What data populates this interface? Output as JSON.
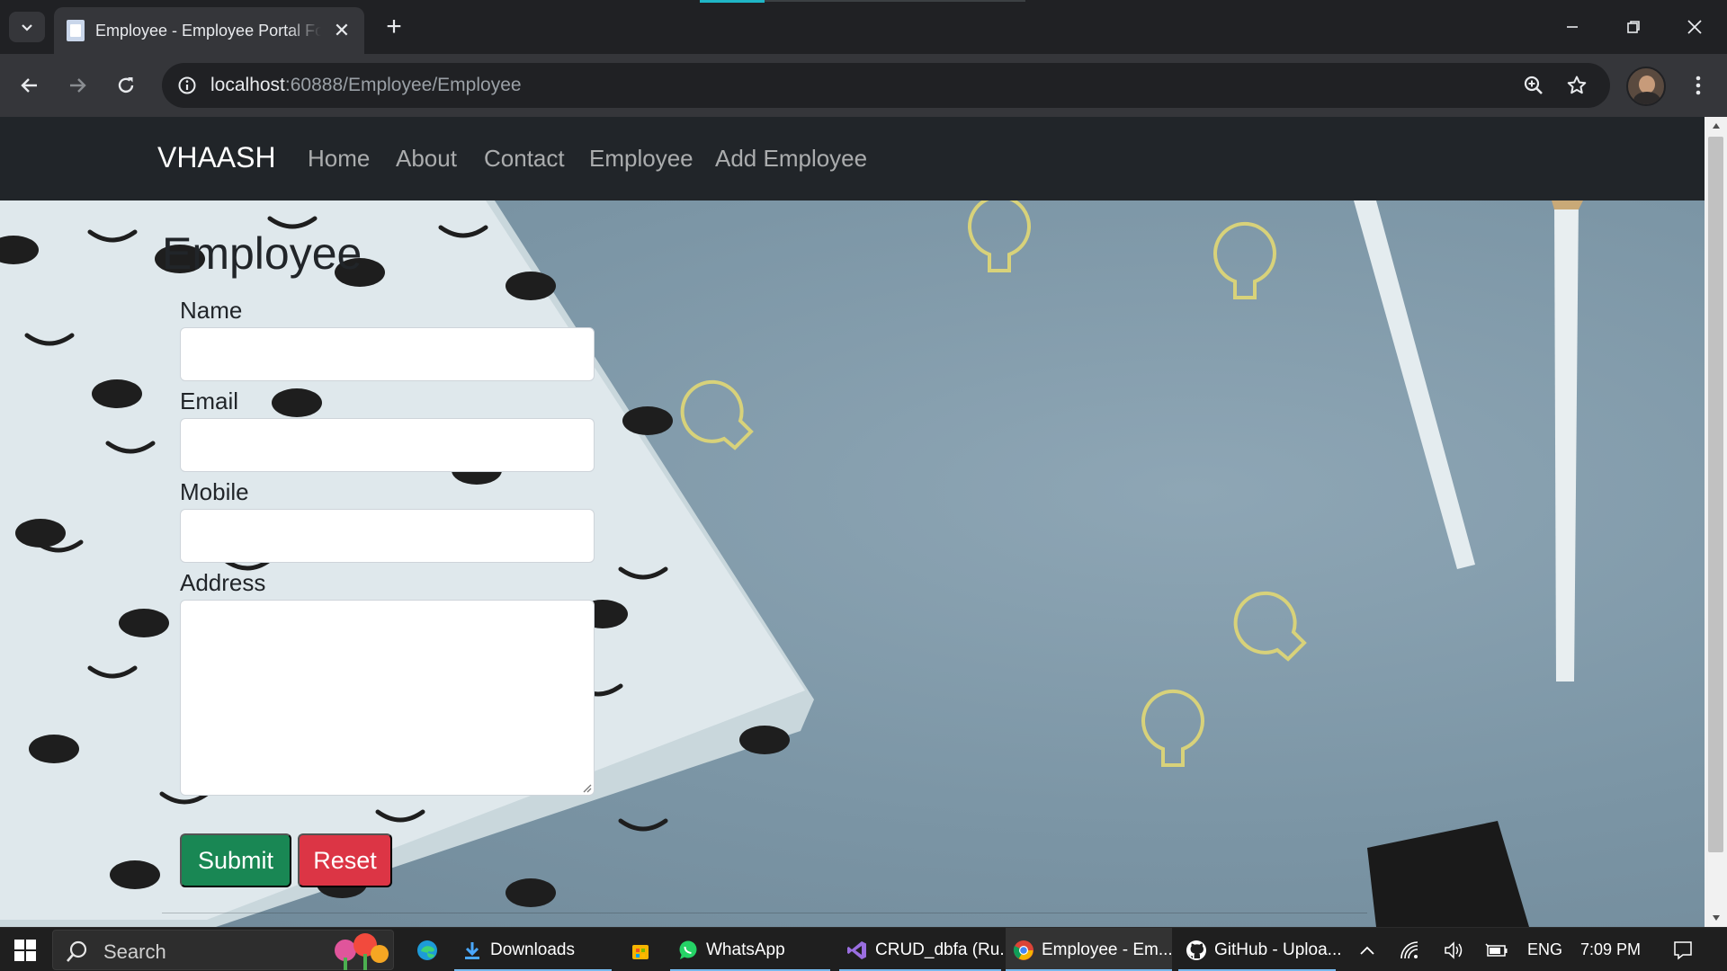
{
  "browser": {
    "tab_title": "Employee - Employee Portal For",
    "url_host": "localhost",
    "url_rest": ":60888/Employee/Employee"
  },
  "site": {
    "brand": "VHAASH",
    "nav": [
      "Home",
      "About",
      "Contact",
      "Employee",
      "Add Employee"
    ],
    "heading": "Employee",
    "form": {
      "name_label": "Name",
      "name_value": "",
      "email_label": "Email",
      "email_value": "",
      "mobile_label": "Mobile",
      "mobile_value": "",
      "address_label": "Address",
      "address_value": "",
      "submit_label": "Submit",
      "reset_label": "Reset"
    }
  },
  "taskbar": {
    "search_placeholder": "Search",
    "apps": [
      "Downloads",
      "WhatsApp",
      "CRUD_dbfa (Ru...",
      "Employee - Em...",
      "GitHub - Uploa..."
    ],
    "language": "ENG",
    "time": "7:09 PM"
  },
  "colors": {
    "site_navbar": "#212529",
    "submit": "#198754",
    "reset": "#dc3545",
    "background": "#7d97a8"
  },
  "icons": [
    "tab-search-icon",
    "page-icon",
    "close-icon",
    "plus-icon",
    "back-icon",
    "forward-icon",
    "reload-icon",
    "info-icon",
    "zoom-icon",
    "star-icon",
    "kebab-menu-icon",
    "windows-icon",
    "search-icon",
    "edge-icon",
    "download-icon",
    "store-icon",
    "whatsapp-icon",
    "visual-studio-icon",
    "chrome-icon",
    "github-icon",
    "chevron-up-icon",
    "wifi-icon",
    "volume-icon",
    "battery-icon",
    "notification-icon"
  ]
}
